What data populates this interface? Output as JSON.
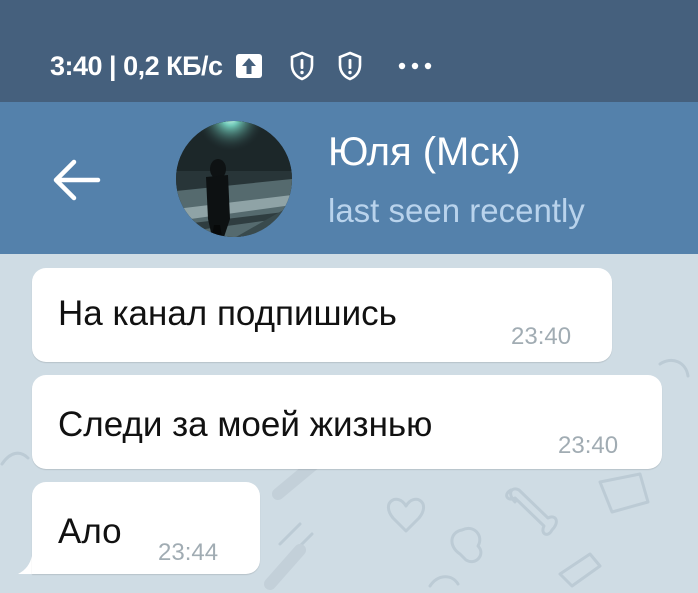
{
  "status_bar": {
    "text": "3:40 | 0,2 КБ/с",
    "icons": [
      "upload-icon",
      "shield-alert-icon",
      "shield-alert-icon",
      "more-dots-icon"
    ]
  },
  "header": {
    "back_icon": "arrow-left-icon",
    "contact_name": "Юля (Мск)",
    "contact_status": "last seen recently",
    "colors": {
      "header_bg": "#5481ab",
      "status_bar_bg": "#45607d",
      "status_text": "#b9d3ec"
    }
  },
  "messages": [
    {
      "text": "На канал подпишись",
      "time": "23:40"
    },
    {
      "text": "Следи за моей жизнью",
      "time": "23:40"
    },
    {
      "text": "Ало",
      "time": "23:44"
    }
  ],
  "chat": {
    "background": "#cfdce4",
    "bubble": "#ffffff"
  }
}
